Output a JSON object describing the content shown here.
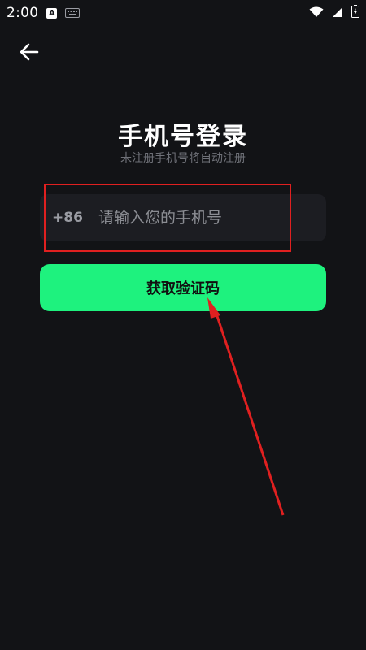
{
  "status_bar": {
    "time": "2:00",
    "app_badge": "A",
    "icons": [
      "text-a-icon",
      "keyboard-icon",
      "wifi-icon",
      "signal-icon",
      "battery-charging-icon"
    ]
  },
  "header": {
    "back_icon": "arrow-left-icon"
  },
  "login": {
    "title": "手机号登录",
    "subtitle": "未注册手机号将自动注册",
    "country_code": "+86",
    "phone_placeholder": "请输入您的手机号",
    "get_code_label": "获取验证码"
  },
  "annotations": {
    "highlight_color": "#e02020",
    "arrow_color": "#e02020"
  },
  "colors": {
    "background": "#121316",
    "accent": "#1ef27e",
    "input_background": "#1c1d22"
  }
}
